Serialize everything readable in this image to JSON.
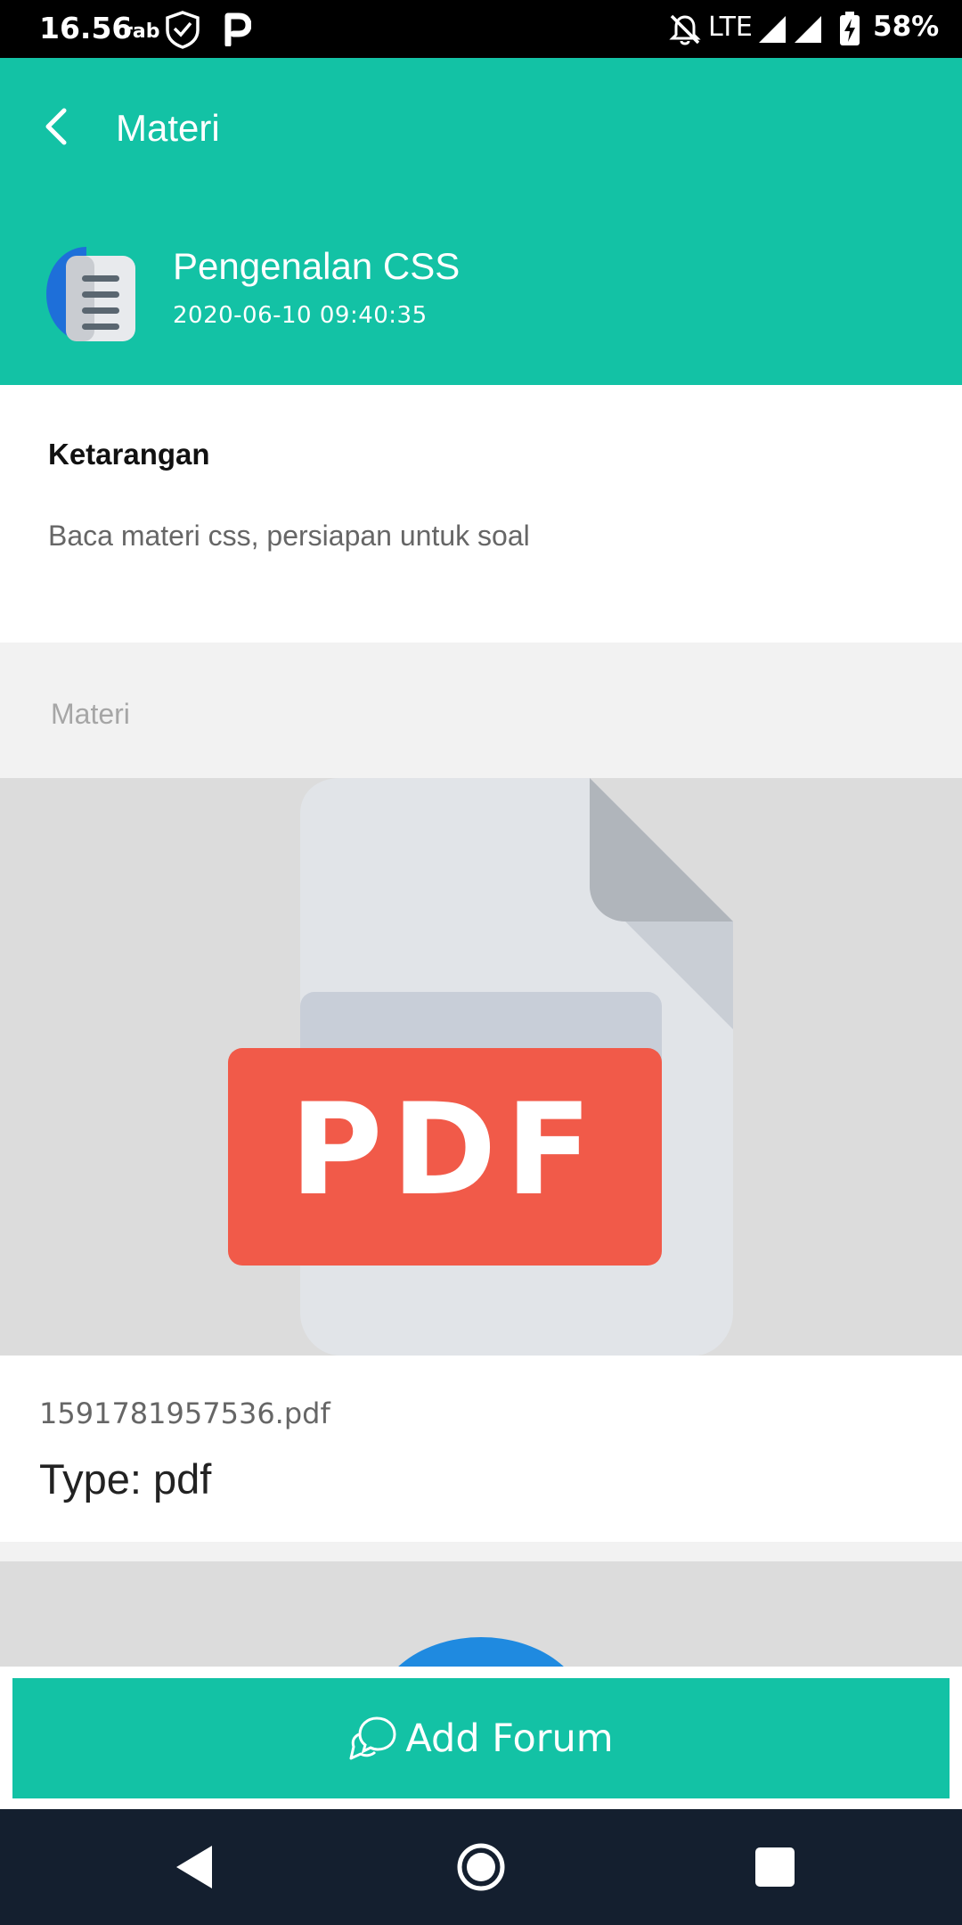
{
  "status_bar": {
    "time": "16.56",
    "day": "rab",
    "network": "LTE",
    "battery": "58%",
    "icons": [
      "shield-icon",
      "parking-icon",
      "notifications-off-icon",
      "signal-icon",
      "signal-icon",
      "battery-charging-icon"
    ]
  },
  "header": {
    "title": "Materi",
    "back_icon": "chevron-left-icon"
  },
  "material": {
    "title": "Pengenalan CSS",
    "date": "2020-06-10 09:40:35",
    "avatar_icon": "document-icon"
  },
  "description": {
    "heading": "Ketarangan",
    "text": "Baca materi css, persiapan untuk soal"
  },
  "section": {
    "label": "Materi"
  },
  "file": {
    "preview_badge": "PDF",
    "name": "1591781957536.pdf",
    "type_label": "Type: pdf",
    "icon": "pdf-file-icon"
  },
  "actions": {
    "add_forum_label": "Add Forum",
    "add_forum_icon": "chat-bubbles-icon"
  },
  "nav": {
    "icons": [
      "back-triangle-icon",
      "home-circle-icon",
      "recents-square-icon"
    ]
  },
  "colors": {
    "accent": "#13c2a5",
    "pdf_red": "#f15a49",
    "status_bar": "#000000",
    "nav_bar": "#141f2f"
  }
}
